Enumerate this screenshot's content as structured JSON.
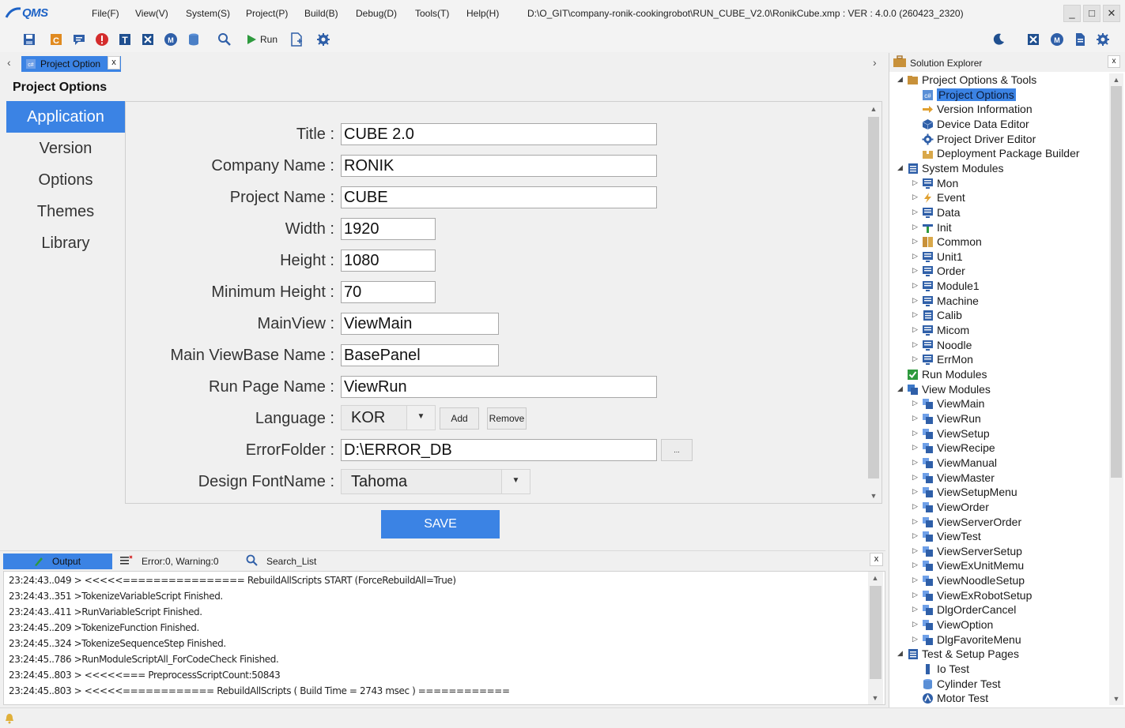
{
  "app": {
    "logo_text": "QMS",
    "title_path": "D:\\O_GIT\\company-ronik-cookingrobot\\RUN_CUBE_V2.0\\RonikCube.xmp :  VER : 4.0.0 (260423_2320)",
    "window_buttons": [
      "_",
      "□",
      "✕"
    ]
  },
  "menu": [
    "File(F)",
    "View(V)",
    "System(S)",
    "Project(P)",
    "Build(B)",
    "Debug(D)",
    "Tools(T)",
    "Help(H)"
  ],
  "toolbar": {
    "run_label": "Run"
  },
  "doc_tab": {
    "label": "Project Option",
    "close": "x"
  },
  "project_options": {
    "title": "Project Options",
    "nav": [
      "Application",
      "Version",
      "Options",
      "Themes",
      "Library"
    ],
    "fields": {
      "title": {
        "label": "Title :",
        "value": "CUBE 2.0"
      },
      "company": {
        "label": "Company Name :",
        "value": "RONIK"
      },
      "project": {
        "label": "Project Name :",
        "value": "CUBE"
      },
      "width": {
        "label": "Width :",
        "value": "1920"
      },
      "height": {
        "label": "Height :",
        "value": "1080"
      },
      "min_height": {
        "label": "Minimum Height :",
        "value": "70"
      },
      "main_view": {
        "label": "MainView :",
        "value": "ViewMain"
      },
      "main_viewbase": {
        "label": "Main ViewBase Name :",
        "value": "BasePanel"
      },
      "run_page": {
        "label": "Run Page Name :",
        "value": "ViewRun"
      },
      "language": {
        "label": "Language :",
        "value": "KOR",
        "add": "Add",
        "remove": "Remove"
      },
      "error_folder": {
        "label": "ErrorFolder :",
        "value": "D:\\ERROR_DB",
        "browse": "..."
      },
      "design_font": {
        "label": "Design FontName :",
        "value": "Tahoma"
      }
    },
    "save_label": "SAVE"
  },
  "output": {
    "tabs": [
      "Output",
      "Error:0, Warning:0",
      "Search_List"
    ],
    "close": "x",
    "lines": [
      "23:24:43..049 > <<<<<================ RebuildAllScripts START   (ForceRebuildAll=True)",
      "23:24:43..351 >TokenizeVariableScript Finished.",
      "23:24:43..411 >RunVariableScript Finished.",
      "23:24:45..209 >TokenizeFunction Finished.",
      "23:24:45..324 >TokenizeSequenceStep Finished.",
      "23:24:45..786 >RunModuleScriptAll_ForCodeCheck Finished.",
      "23:24:45..803 > <<<<<=== PreprocessScriptCount:50843",
      "23:24:45..803 > <<<<<============ RebuildAllScripts ( Build Time = 2743 msec ) ============"
    ]
  },
  "solution_explorer": {
    "title": "Solution Explorer",
    "close": "x",
    "nodes": [
      {
        "label": "Project Options & Tools",
        "level": 0,
        "expander": "◢",
        "icon": "folder-icon"
      },
      {
        "label": "Project Options",
        "level": 1,
        "expander": "",
        "icon": "project-options-icon",
        "selected": true
      },
      {
        "label": "Version Information",
        "level": 1,
        "expander": "",
        "icon": "version-icon"
      },
      {
        "label": "Device Data Editor",
        "level": 1,
        "expander": "",
        "icon": "device-data-icon"
      },
      {
        "label": "Project Driver Editor",
        "level": 1,
        "expander": "",
        "icon": "driver-gear-icon"
      },
      {
        "label": "Deployment Package Builder",
        "level": 1,
        "expander": "",
        "icon": "package-icon"
      },
      {
        "label": "System Modules",
        "level": 0,
        "expander": "◢",
        "icon": "module-stack-icon"
      },
      {
        "label": "Mon",
        "level": 1,
        "expander": "▷",
        "icon": "module-icon"
      },
      {
        "label": "Event",
        "level": 1,
        "expander": "▷",
        "icon": "event-bolt-icon"
      },
      {
        "label": "Data",
        "level": 1,
        "expander": "▷",
        "icon": "module-icon"
      },
      {
        "label": "Init",
        "level": 1,
        "expander": "▷",
        "icon": "init-icon"
      },
      {
        "label": "Common",
        "level": 1,
        "expander": "▷",
        "icon": "common-icon"
      },
      {
        "label": "Unit1",
        "level": 1,
        "expander": "▷",
        "icon": "module-icon"
      },
      {
        "label": "Order",
        "level": 1,
        "expander": "▷",
        "icon": "module-icon"
      },
      {
        "label": "Module1",
        "level": 1,
        "expander": "▷",
        "icon": "module-icon"
      },
      {
        "label": "Machine",
        "level": 1,
        "expander": "▷",
        "icon": "module-icon"
      },
      {
        "label": "Calib",
        "level": 1,
        "expander": "▷",
        "icon": "module-stack-icon"
      },
      {
        "label": "Micom",
        "level": 1,
        "expander": "▷",
        "icon": "module-icon"
      },
      {
        "label": "Noodle",
        "level": 1,
        "expander": "▷",
        "icon": "module-icon"
      },
      {
        "label": "ErrMon",
        "level": 1,
        "expander": "▷",
        "icon": "module-icon"
      },
      {
        "label": "Run Modules",
        "level": 0,
        "expander": "",
        "icon": "run-check-icon"
      },
      {
        "label": "View Modules",
        "level": 0,
        "expander": "◢",
        "icon": "view-stack-icon"
      },
      {
        "label": "ViewMain",
        "level": 1,
        "expander": "▷",
        "icon": "view-icon"
      },
      {
        "label": "ViewRun",
        "level": 1,
        "expander": "▷",
        "icon": "view-icon"
      },
      {
        "label": "ViewSetup",
        "level": 1,
        "expander": "▷",
        "icon": "view-icon"
      },
      {
        "label": "ViewRecipe",
        "level": 1,
        "expander": "▷",
        "icon": "view-icon"
      },
      {
        "label": "ViewManual",
        "level": 1,
        "expander": "▷",
        "icon": "view-icon"
      },
      {
        "label": "ViewMaster",
        "level": 1,
        "expander": "▷",
        "icon": "view-icon"
      },
      {
        "label": "ViewSetupMenu",
        "level": 1,
        "expander": "▷",
        "icon": "view-icon"
      },
      {
        "label": "ViewOrder",
        "level": 1,
        "expander": "▷",
        "icon": "view-icon"
      },
      {
        "label": "ViewServerOrder",
        "level": 1,
        "expander": "▷",
        "icon": "view-icon"
      },
      {
        "label": "ViewTest",
        "level": 1,
        "expander": "▷",
        "icon": "view-icon"
      },
      {
        "label": "ViewServerSetup",
        "level": 1,
        "expander": "▷",
        "icon": "view-icon"
      },
      {
        "label": "ViewExUnitMemu",
        "level": 1,
        "expander": "▷",
        "icon": "view-icon"
      },
      {
        "label": "ViewNoodleSetup",
        "level": 1,
        "expander": "▷",
        "icon": "view-icon"
      },
      {
        "label": "ViewExRobotSetup",
        "level": 1,
        "expander": "▷",
        "icon": "view-icon"
      },
      {
        "label": "DlgOrderCancel",
        "level": 1,
        "expander": "▷",
        "icon": "view-icon"
      },
      {
        "label": "ViewOption",
        "level": 1,
        "expander": "▷",
        "icon": "view-icon"
      },
      {
        "label": "DlgFavoriteMenu",
        "level": 1,
        "expander": "▷",
        "icon": "view-icon"
      },
      {
        "label": "Test & Setup Pages",
        "level": 0,
        "expander": "◢",
        "icon": "module-stack-icon"
      },
      {
        "label": "Io Test",
        "level": 1,
        "expander": "",
        "icon": "io-test-icon"
      },
      {
        "label": "Cylinder Test",
        "level": 1,
        "expander": "",
        "icon": "cylinder-icon"
      },
      {
        "label": "Motor Test",
        "level": 1,
        "expander": "",
        "icon": "motor-icon"
      }
    ]
  },
  "colors": {
    "accent": "#3b83e4",
    "background": "#f0f0f0",
    "module_blue": "#2f5fa8",
    "view_blue": "#3c78c8"
  }
}
